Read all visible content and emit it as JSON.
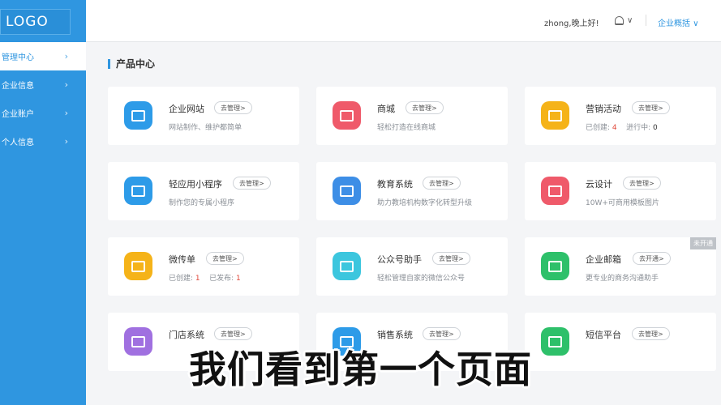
{
  "logo": "LOGO",
  "sidebar": {
    "items": [
      {
        "label": "管理中心"
      },
      {
        "label": "企业信息"
      },
      {
        "label": "企业账户"
      },
      {
        "label": "个人信息"
      }
    ]
  },
  "header": {
    "greeting": "zhong,晚上好!",
    "company_link": "企业概括",
    "chevron": "∨"
  },
  "section_title": "产品中心",
  "cards": [
    {
      "title": "企业网站",
      "button": "去管理>",
      "desc": "网站制作、维护都简单",
      "icon": "website-icon",
      "color": "#2d9be8"
    },
    {
      "title": "商城",
      "button": "去管理>",
      "desc": "轻松打造在线商城",
      "icon": "shop-bag-icon",
      "color": "#ef5a6a"
    },
    {
      "title": "营销活动",
      "button": "去管理>",
      "desc_prefix": "已创建: ",
      "count1": "4",
      "desc_mid": "进行中: ",
      "count2": "0",
      "icon": "gift-icon",
      "color": "#f5b319"
    },
    {
      "title": "轻应用小程序",
      "button": "去管理>",
      "desc": "制作您的专属小程序",
      "icon": "mini-app-icon",
      "color": "#2d9be8"
    },
    {
      "title": "教育系统",
      "button": "去管理>",
      "desc": "助力教培机构数字化转型升级",
      "icon": "book-icon",
      "color": "#3d8ee6"
    },
    {
      "title": "云设计",
      "button": "去管理>",
      "desc": "10W+可商用模板图片",
      "icon": "image-icon",
      "color": "#ef5a6a"
    },
    {
      "title": "微传单",
      "button": "去管理>",
      "desc_prefix": "已创建: ",
      "count1": "1",
      "desc_mid": "已发布: ",
      "count2": "1",
      "icon": "flyer-icon",
      "color": "#f5b319"
    },
    {
      "title": "公众号助手",
      "button": "去管理>",
      "desc": "轻松管理自家的微信公众号",
      "icon": "wechat-icon",
      "color": "#3cc6de"
    },
    {
      "title": "企业邮箱",
      "button": "去开通>",
      "desc": "更专业的商务沟通助手",
      "icon": "mail-icon",
      "color": "#2ec06a",
      "ribbon": "未开通"
    },
    {
      "title": "门店系统",
      "button": "去管理>",
      "desc": "",
      "icon": "store-icon",
      "color": "#a070e0"
    },
    {
      "title": "销售系统",
      "button": "去管理>",
      "desc": "",
      "icon": "sales-icon",
      "color": "#2d9be8"
    },
    {
      "title": "短信平台",
      "button": "去管理>",
      "desc": "",
      "icon": "sms-icon",
      "color": "#2ec06a"
    }
  ],
  "caption": "我们看到第一个页面"
}
